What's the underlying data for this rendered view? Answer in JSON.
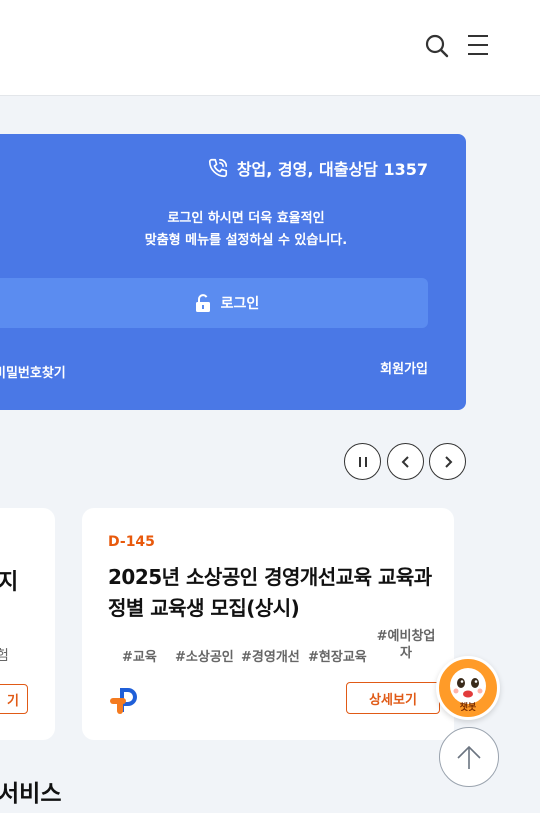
{
  "header": {
    "search_icon": "search-icon",
    "menu_icon": "hamburger-menu-icon"
  },
  "login_card": {
    "phone_text": "창업, 경영, 대출상담 1357",
    "message_line1": "로그인 하시면 더욱 효율적인",
    "message_line2": "맞춤형 메뉴를 설정하실 수 있습니다.",
    "login_label": "로그인",
    "find_password": "비밀번호찾기",
    "signup": "회원가입",
    "accent_color": "#4a78e6"
  },
  "carousel": {
    "pause_icon": "pause-icon",
    "prev_icon": "chevron-left-icon",
    "next_icon": "chevron-right-icon"
  },
  "cards": {
    "left": {
      "title_fragment": "지",
      "tag_fragment": "험",
      "button_fragment": "기"
    },
    "main": {
      "dday": "D-145",
      "title": "2025년 소상공인 경영개선교육 교육과정별 교육생 모집(상시)",
      "tags": [
        "#교육",
        "#소상공인",
        "#경영개선",
        "#현장교육",
        "#예비창업자"
      ],
      "detail_label": "상세보기",
      "accent_color": "#e05a16"
    }
  },
  "chatbot": {
    "label": "챗봇"
  },
  "section": {
    "title": "서비스"
  }
}
